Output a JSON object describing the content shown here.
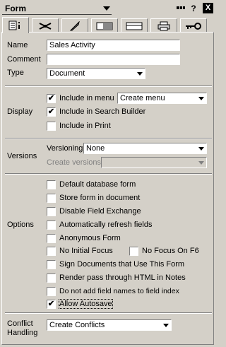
{
  "titlebar": {
    "type_value": "Form",
    "help_icon": "?",
    "close_icon": "X"
  },
  "tabs": [
    {
      "name": "tab-info",
      "icon": "info-icon",
      "active": true
    },
    {
      "name": "tab-defaults",
      "icon": "propeller-icon",
      "active": false
    },
    {
      "name": "tab-launch",
      "icon": "rocket-icon",
      "active": false
    },
    {
      "name": "tab-background",
      "icon": "background-icon",
      "active": false
    },
    {
      "name": "tab-header",
      "icon": "header-icon",
      "active": false
    },
    {
      "name": "tab-print",
      "icon": "printer-icon",
      "active": false
    },
    {
      "name": "tab-security",
      "icon": "key-icon",
      "active": false
    }
  ],
  "basics": {
    "name_label": "Name",
    "name_value": "Sales Activity",
    "comment_label": "Comment",
    "comment_value": "",
    "type_label": "Type",
    "type_value": "Document"
  },
  "display": {
    "section_label": "Display",
    "include_in_menu": {
      "label": "Include in menu",
      "checked": true
    },
    "menu_value": "Create menu",
    "include_in_search": {
      "label": "Include in Search Builder",
      "checked": true
    },
    "include_in_print": {
      "label": "Include in Print",
      "checked": false
    }
  },
  "versions": {
    "section_label": "Versions",
    "versioning_label": "Versioning",
    "versioning_value": "None",
    "create_versions_label": "Create versions",
    "create_versions_value": ""
  },
  "options": {
    "section_label": "Options",
    "items": [
      {
        "label": "Default database form",
        "checked": false
      },
      {
        "label": "Store form in document",
        "checked": false
      },
      {
        "label": "Disable Field Exchange",
        "checked": false
      },
      {
        "label": "Automatically refresh fields",
        "checked": false
      },
      {
        "label": "Anonymous Form",
        "checked": false
      },
      {
        "label": "No Initial Focus",
        "checked": false
      },
      {
        "label": "Sign Documents that Use This Form",
        "checked": false
      },
      {
        "label": "Render pass through HTML in Notes",
        "checked": false
      },
      {
        "label": "Do not add field names to field index",
        "checked": false
      },
      {
        "label": "Allow Autosave",
        "checked": true
      }
    ],
    "no_focus_f6": {
      "label": "No Focus On F6",
      "checked": false
    }
  },
  "conflict": {
    "section_label_line1": "Conflict",
    "section_label_line2": "Handling",
    "value": "Create Conflicts"
  }
}
